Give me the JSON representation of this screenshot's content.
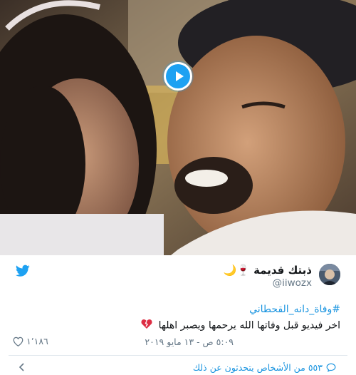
{
  "author": {
    "display_name": "ذبتك قديمة 🍷🌙",
    "handle": "@iiwozx"
  },
  "tweet": {
    "hashtag": "#وفاة_دانه_القحطاني",
    "text": "اخر فيديو قبل وفاتها الله يرحمها ويصبر اهلها",
    "likes": "١٬١٨٦",
    "timestamp": "٥:٠٩ ص - ١٣ مايو ٢٠١٩"
  },
  "footer": {
    "conversation_text": "٥٥٣ من الأشخاص يتحدثون عن ذلك"
  },
  "icons": {
    "brand": "twitter-bird-icon",
    "play": "play-icon",
    "like": "heart-outline-icon",
    "reply": "speech-bubble-icon",
    "expand": "chevron-left-icon",
    "emoji": "broken-heart-icon"
  },
  "colors": {
    "accent": "#1da1f2",
    "link": "#1b95e0",
    "muted": "#657786",
    "text": "#14171a"
  }
}
